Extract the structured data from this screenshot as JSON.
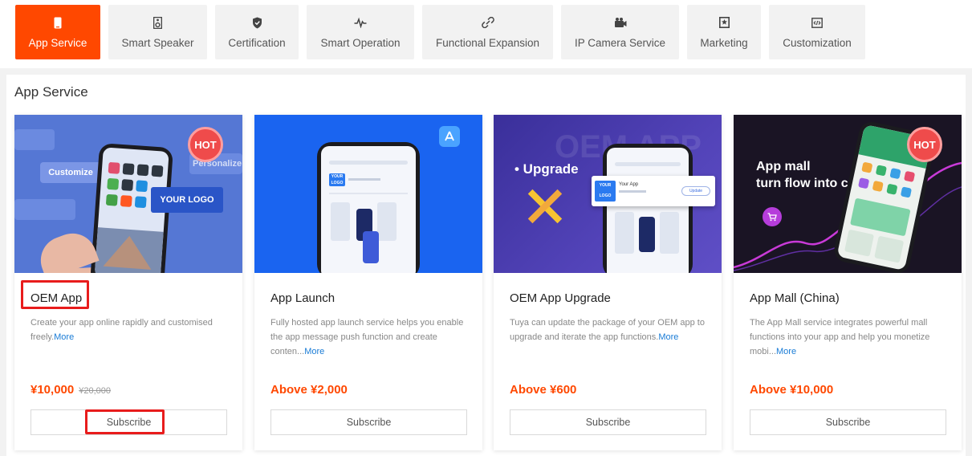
{
  "tabs": [
    {
      "label": "App Service",
      "icon": "phone-icon",
      "active": true
    },
    {
      "label": "Smart Speaker",
      "icon": "speaker-icon",
      "active": false
    },
    {
      "label": "Certification",
      "icon": "shield-icon",
      "active": false
    },
    {
      "label": "Smart Operation",
      "icon": "pulse-icon",
      "active": false
    },
    {
      "label": "Functional Expansion",
      "icon": "link-icon",
      "active": false
    },
    {
      "label": "IP Camera Service",
      "icon": "camera-icon",
      "active": false
    },
    {
      "label": "Marketing",
      "icon": "bookmark-icon",
      "active": false
    },
    {
      "label": "Customization",
      "icon": "code-icon",
      "active": false
    }
  ],
  "section": {
    "title": "App Service"
  },
  "cards": [
    {
      "title": "OEM App",
      "desc": "Create your app online rapidly and customised freely.",
      "more": "More",
      "price": "¥10,000",
      "orig_price": "¥20,000",
      "button": "Subscribe",
      "badge": "HOT",
      "image": {
        "customize": "Customize",
        "ersonalize": "Personalize",
        "logo": "YOUR LOGO"
      }
    },
    {
      "title": "App Launch",
      "desc": "Fully hosted app launch service helps you enable the app message push function and create conten...",
      "more": "More",
      "price": "Above ¥2,000",
      "button": "Subscribe",
      "image": {
        "logo": "YOUR LOGO"
      }
    },
    {
      "title": "OEM App Upgrade",
      "desc": "Tuya can update the package of your OEM app to upgrade and iterate the app functions.",
      "more": "More",
      "price": "Above ¥600",
      "button": "Subscribe",
      "image": {
        "upgrade": "• Upgrade",
        "watermark": "OEM APP",
        "your_app": "Your App",
        "update": "Update",
        "logo": "YOUR LOGO"
      }
    },
    {
      "title": "App Mall (China)",
      "desc": "The App Mall service integrates powerful mall functions into your app and help you monetize mobi...",
      "more": "More",
      "price": "Above ¥10,000",
      "button": "Subscribe",
      "badge": "HOT",
      "image": {
        "line1": "App mall",
        "line2": "turn flow into cash"
      }
    }
  ],
  "colors": {
    "accent": "#ff4800",
    "highlight": "#e81c1c",
    "link": "#1a7cd6"
  }
}
